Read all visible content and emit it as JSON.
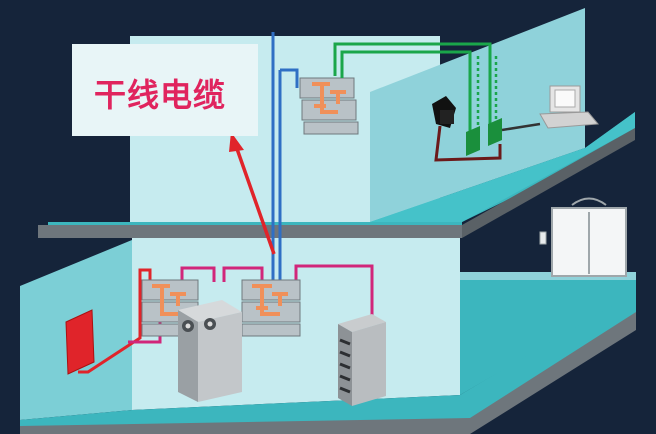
{
  "callout": {
    "label": "干线电缆"
  },
  "colors": {
    "background": "#15243a",
    "wall": "#b9e3e8",
    "floor": "#3cb6be",
    "slab": "#6e767c",
    "backbone_cable": "#2f6fc4",
    "horizontal_cable": "#d1267a",
    "patch_cable_red": "#e0242a",
    "data_cable_green": "#1aa64a",
    "drop_cable_dark": "#6b1a1a",
    "pointer_arrow": "#e0242a",
    "callout_text": "#e0245e"
  },
  "icons": [
    "patch-panel-icon",
    "server-cabinet-icon",
    "network-rack-icon",
    "telephone-icon",
    "computer-icon",
    "wall-outlet-icon",
    "fire-alarm-box-icon",
    "elevator-icon",
    "arrow-icon"
  ]
}
